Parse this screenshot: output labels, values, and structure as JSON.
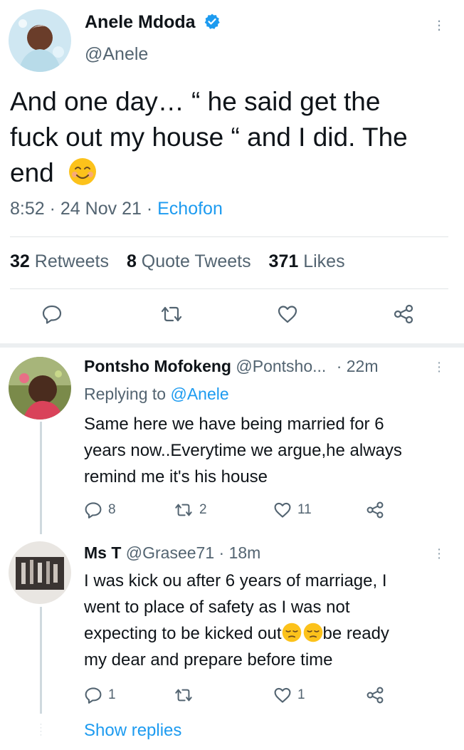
{
  "main_tweet": {
    "author_name": "Anele Mdoda",
    "author_handle": "@Anele",
    "text_line1": "And one day… “ he said get the",
    "text_line2": "fuck out my house “ and I did. The",
    "text_line3": "end",
    "time": "8:52",
    "date": "24 Nov 21",
    "source": "Echofon",
    "retweets_count": "32",
    "retweets_label": "Retweets",
    "quote_count": "8",
    "quote_label": "Quote Tweets",
    "likes_count": "371",
    "likes_label": "Likes",
    "verified_color": "#1d9bf0",
    "actions": [
      "reply-icon",
      "retweet-icon",
      "like-icon",
      "share-icon"
    ]
  },
  "replies": [
    {
      "name": "Pontsho Mofokeng",
      "handle": "@Pontsho...",
      "time": "· 22m",
      "replying_prefix": "Replying to",
      "replying_mention": "@Anele",
      "text_lines": [
        "Same here we have being married for 6",
        "years now..Everytime we argue,he always",
        "remind me it's his house"
      ],
      "reply_count": "8",
      "retweet_count": "2",
      "like_count": "11"
    },
    {
      "name": "Ms T",
      "handle": "@Grasee71",
      "time": "· 18m",
      "text_lines": [
        "I was kick ou after 6 years of marriage, I",
        "went to place of safety as I was not",
        "expecting to be kicked out",
        "be ready",
        "my dear and prepare before time"
      ],
      "reply_count": "1",
      "retweet_count": "",
      "like_count": "1"
    }
  ],
  "show_replies_label": "Show replies",
  "colors": {
    "accent": "#1d9bf0",
    "secondary_text": "#536471",
    "primary_text": "#0f1419"
  }
}
